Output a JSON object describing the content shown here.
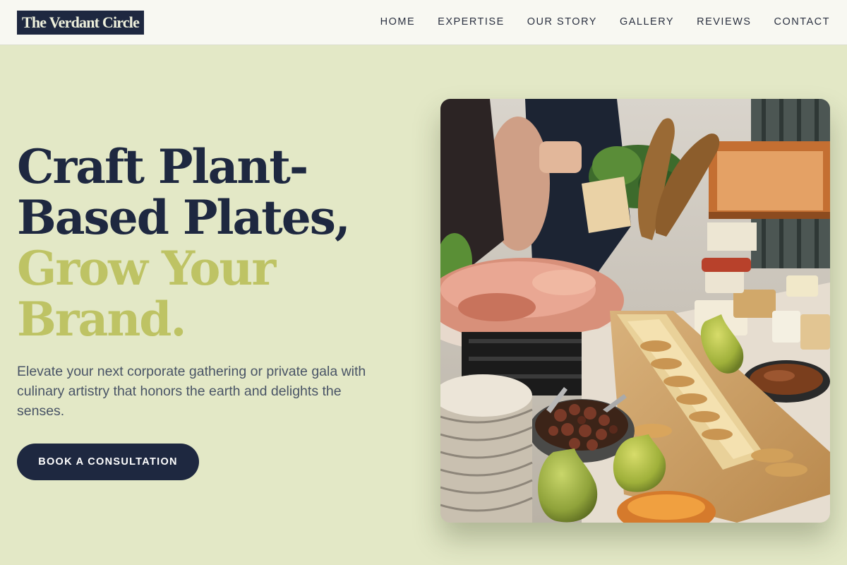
{
  "brand": {
    "name": "The Verdant Circle"
  },
  "nav": {
    "items": [
      {
        "label": "HOME"
      },
      {
        "label": "EXPERTISE"
      },
      {
        "label": "OUR STORY"
      },
      {
        "label": "GALLERY"
      },
      {
        "label": "REVIEWS"
      },
      {
        "label": "CONTACT"
      }
    ]
  },
  "hero": {
    "title_line_1": "Craft Plant-",
    "title_line_2": "Based Plates,",
    "title_line_3": "Grow Your",
    "title_line_4": "Brand.",
    "description": "Elevate your next corporate gathering or private gala with culinary artistry that honors the earth and delights the senses.",
    "cta_label": "BOOK A CONSULTATION",
    "image_alt": "Catering buffet table with charcuterie, baguettes, cheeses, pears and olives"
  },
  "colors": {
    "background": "#e3e8c6",
    "navy": "#1e2840",
    "accent": "#bec364",
    "nav_background": "#f8f8f2"
  }
}
